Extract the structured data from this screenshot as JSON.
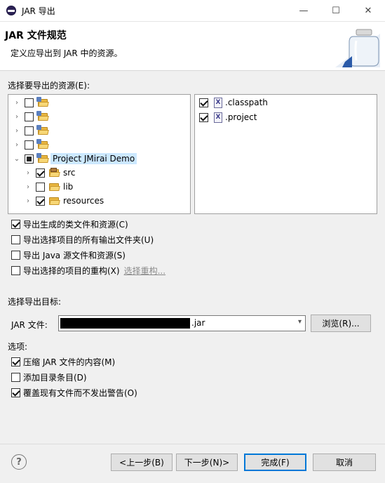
{
  "window": {
    "title": "JAR 导出",
    "minimize": "—",
    "maximize": "☐",
    "close": "✕"
  },
  "header": {
    "title": "JAR 文件规范",
    "description": "定义应导出到 JAR 中的资源。"
  },
  "resources_label": "选择要导出的资源(E):",
  "tree": [
    {
      "label": "",
      "checked": false
    },
    {
      "label": "",
      "checked": false
    },
    {
      "label": "",
      "checked": false
    },
    {
      "label": "",
      "checked": false
    },
    {
      "label": "Project JMirai Demo",
      "state": "partial",
      "selected": true
    },
    {
      "label": "src",
      "checked": true
    },
    {
      "label": "lib",
      "checked": false
    },
    {
      "label": "resources",
      "checked": true
    }
  ],
  "files": [
    {
      "label": ".classpath",
      "checked": true
    },
    {
      "label": ".project",
      "checked": true
    }
  ],
  "export_options": [
    {
      "label": "导出生成的类文件和资源(C)",
      "checked": true
    },
    {
      "label": "导出选择项目的所有输出文件夹(U)",
      "checked": false
    },
    {
      "label": "导出 Java 源文件和资源(S)",
      "checked": false
    },
    {
      "label": "导出选择的项目的重构(X)",
      "checked": false,
      "link": "选择重构..."
    }
  ],
  "destination": {
    "section_label": "选择导出目标:",
    "jar_label": "JAR 文件:",
    "value_suffix": ".jar",
    "browse": "浏览(R)..."
  },
  "options": {
    "section_label": "选项:",
    "items": [
      {
        "label": "压缩 JAR 文件的内容(M)",
        "checked": true
      },
      {
        "label": "添加目录条目(D)",
        "checked": false
      },
      {
        "label": "覆盖现有文件而不发出警告(O)",
        "checked": true
      }
    ]
  },
  "buttons": {
    "back": "<上一步(B)",
    "next": "下一步(N)>",
    "finish": "完成(F)",
    "cancel": "取消",
    "help": "?"
  }
}
